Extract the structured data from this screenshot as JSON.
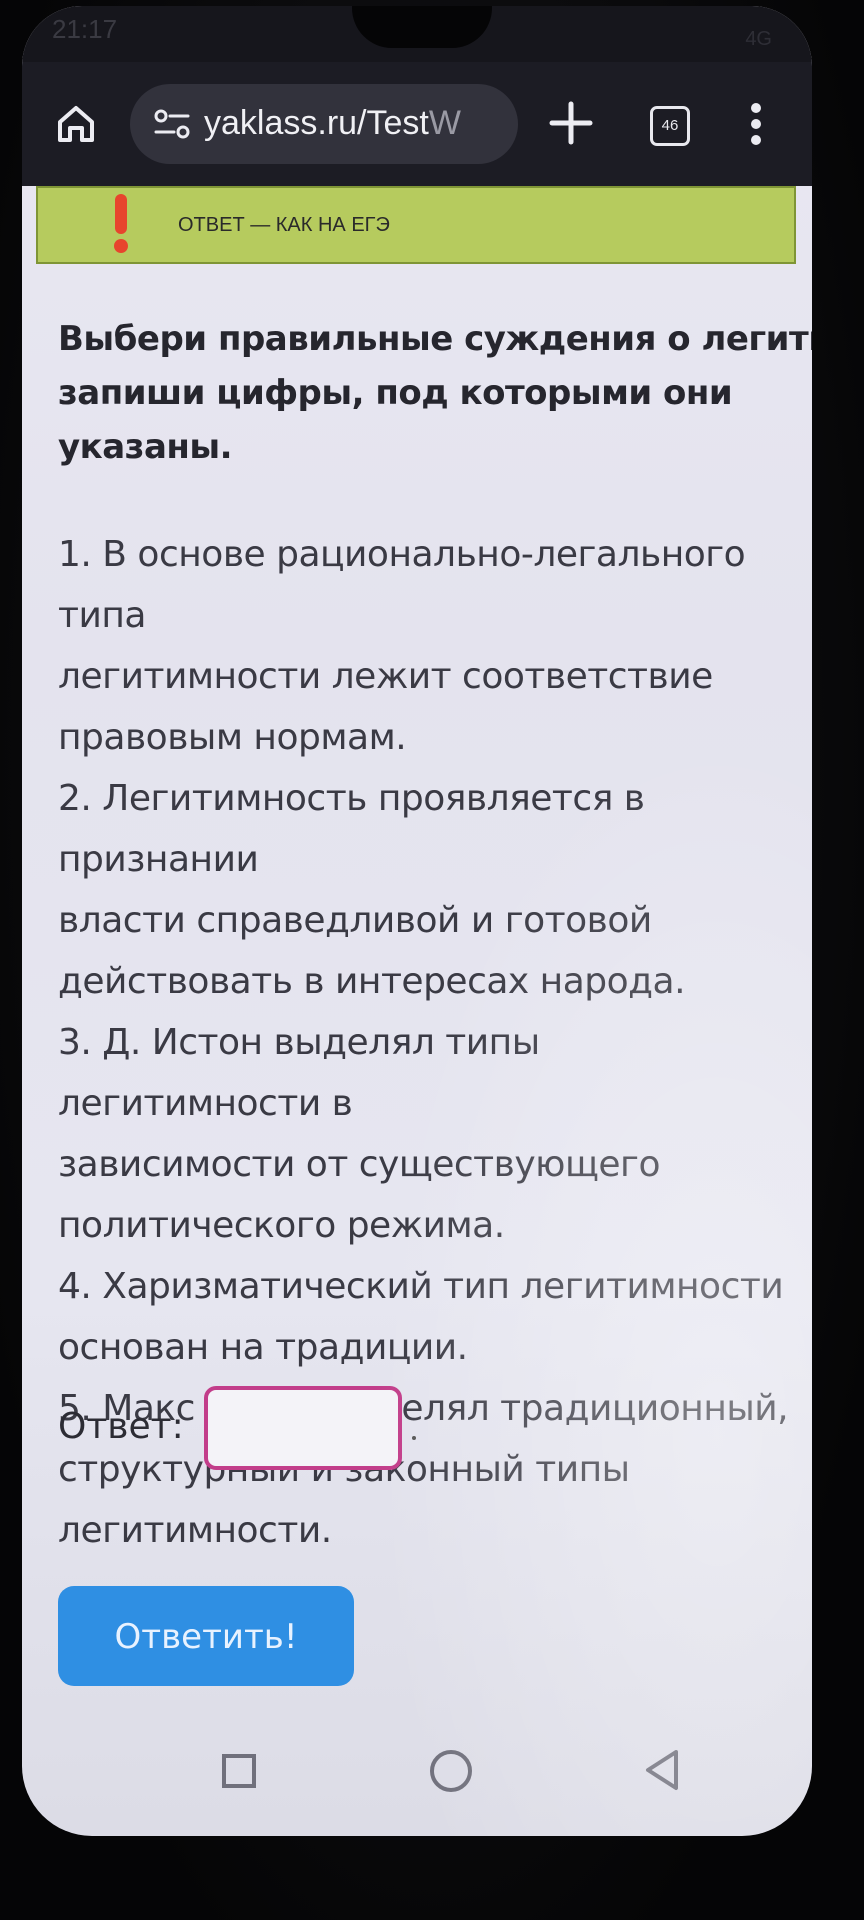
{
  "status_bar": {
    "time": "21:17",
    "right": "4G"
  },
  "browser": {
    "url_main": "yaklass.ru/Test",
    "url_faded": "W",
    "tabs_count": "46",
    "icons": {
      "home": "home-icon",
      "site_settings": "tune-icon",
      "new_tab": "plus-icon",
      "menu": "more-vert-icon"
    }
  },
  "banner": {
    "text": "ОТВЕТ — КАК НА ЕГЭ",
    "icon": "exclamation-icon",
    "background": "#b6cb5e"
  },
  "question": {
    "lines": [
      "Выбери правильные суждения о легитимност",
      "запиши цифры, под которыми они",
      "указаны."
    ]
  },
  "statements": [
    [
      "1. В основе рационально-легального типа",
      "легитимности лежит соответствие",
      "правовым нормам."
    ],
    [
      "2. Легитимность проявляется в признании",
      "власти справедливой и готовой",
      "действовать в интересах народа."
    ],
    [
      "3. Д. Истон выделял типы легитимности в",
      "зависимости от существующего",
      "политического режима."
    ],
    [
      "4. Харизматический тип легитимности",
      "основан на традиции."
    ],
    [
      "5. Макс Вебер выделял традиционный,",
      "структурный и законный типы",
      "легитимности."
    ]
  ],
  "answer": {
    "label": "Ответ:",
    "value": "",
    "border_color": "#c23d8a"
  },
  "submit": {
    "label": "Ответить!",
    "color": "#2f8fe3"
  },
  "nav": {
    "icons": [
      "recents-icon",
      "home-circle-icon",
      "back-icon"
    ]
  }
}
